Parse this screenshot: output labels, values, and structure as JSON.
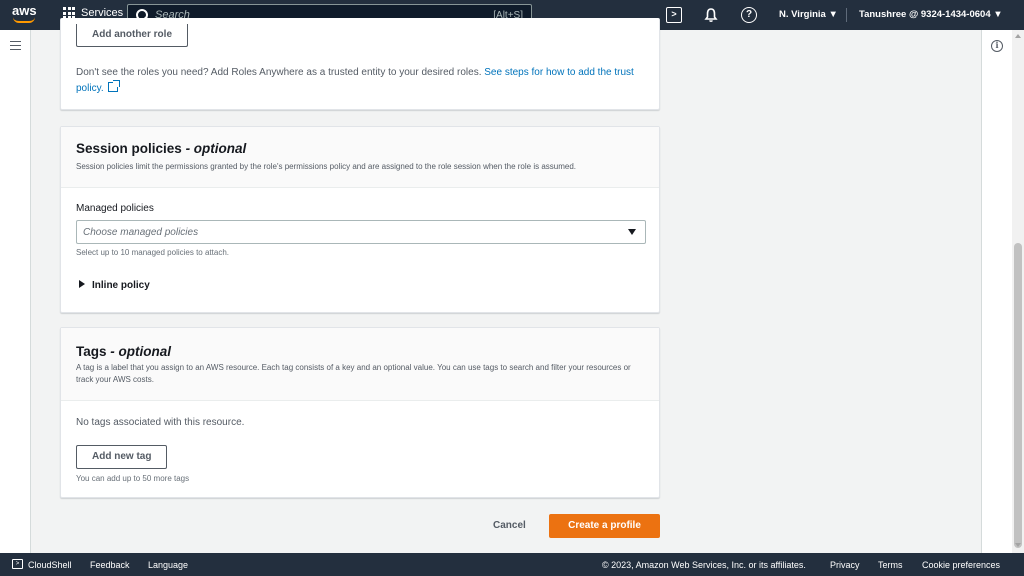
{
  "topnav": {
    "logo_text": "aws",
    "services_label": "Services",
    "search_placeholder": "Search",
    "search_shortcut": "[Alt+S]",
    "region": "N. Virginia ▼",
    "account": "Tanushree @ 9324-1434-0604 ▼"
  },
  "roles_panel": {
    "add_role_button": "Add another role",
    "note_text": "Don't see the roles you need? Add Roles Anywhere as a trusted entity to your desired roles. ",
    "note_link": "See steps for how to add the trust policy."
  },
  "session_panel": {
    "title": "Session policies",
    "title_suffix": "- optional",
    "description": "Session policies limit the permissions granted by the role's permissions policy and are assigned to the role session when the role is assumed.",
    "managed_label": "Managed policies",
    "select_placeholder": "Choose managed policies",
    "select_hint": "Select up to 10 managed policies to attach.",
    "inline_policy": "Inline policy"
  },
  "tags_panel": {
    "title": "Tags",
    "title_suffix": "- optional",
    "description": "A tag is a label that you assign to an AWS resource. Each tag consists of a key and an optional value. You can use tags to search and filter your resources or track your AWS costs.",
    "empty_text": "No tags associated with this resource.",
    "add_tag_button": "Add new tag",
    "limit_hint": "You can add up to 50 more tags"
  },
  "actions": {
    "cancel": "Cancel",
    "create": "Create a profile"
  },
  "footer": {
    "cloudshell": "CloudShell",
    "feedback": "Feedback",
    "language": "Language",
    "copyright": "© 2023, Amazon Web Services, Inc. or its affiliates.",
    "privacy": "Privacy",
    "terms": "Terms",
    "cookie": "Cookie preferences"
  },
  "colors": {
    "nav_bg": "#232f3e",
    "primary_button": "#ec7211",
    "link": "#0073bb"
  }
}
